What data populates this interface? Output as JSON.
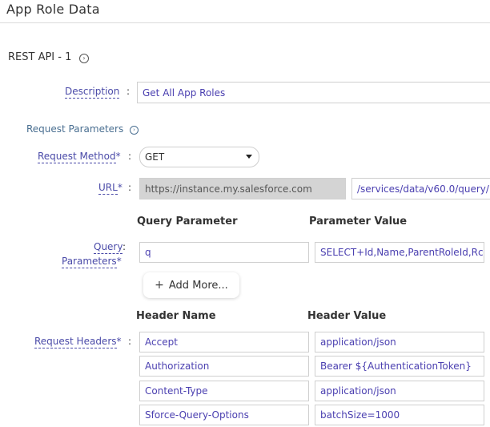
{
  "page": {
    "title": "App Role Data"
  },
  "section": {
    "title": "REST API - 1",
    "expand_icon": "chevron-right-circle-icon"
  },
  "description": {
    "label": "Description",
    "colon": ":",
    "value": "Get All App Roles"
  },
  "request_parameters": {
    "title": "Request Parameters",
    "icon": "chevron-right-circle-icon"
  },
  "request_method": {
    "label": "Request Method",
    "required_mark": "*",
    "colon": ":",
    "value": "GET"
  },
  "url": {
    "label": "URL",
    "required_mark": "*",
    "colon": ":",
    "base": "https://instance.my.salesforce.com",
    "path": "/services/data/v60.0/query/"
  },
  "query_parameters": {
    "label": "Query Parameters",
    "label_line1": "Query",
    "label_line2": "Parameters",
    "required_mark": "*",
    "colon": ":",
    "col_name": "Query Parameter",
    "col_value": "Parameter Value",
    "rows": [
      {
        "name": "q",
        "value": "SELECT+Id,Name,ParentRoleId,Rc"
      }
    ],
    "add_more_label": "Add More...",
    "add_more_icon": "plus-icon"
  },
  "request_headers": {
    "label": "Request Headers",
    "required_mark": "*",
    "colon": ":",
    "col_name": "Header Name",
    "col_value": "Header Value",
    "rows": [
      {
        "name": "Accept",
        "value": "application/json"
      },
      {
        "name": "Authorization",
        "value": "Bearer ${AuthenticationToken}"
      },
      {
        "name": "Content-Type",
        "value": "application/json"
      },
      {
        "name": "Sforce-Query-Options",
        "value": "batchSize=1000"
      }
    ]
  }
}
